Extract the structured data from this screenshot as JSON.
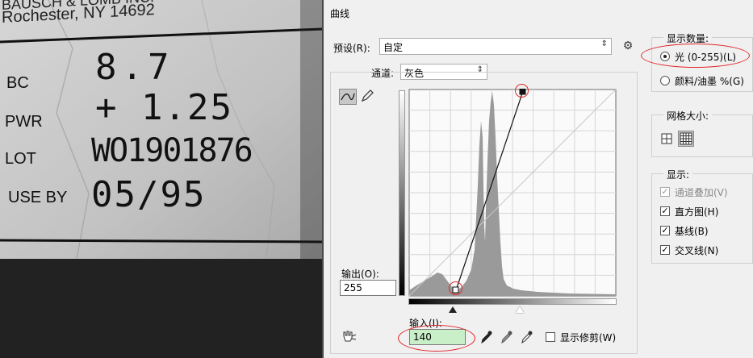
{
  "photo": {
    "header_text": "Rochester, NY 14692",
    "header_partial": "BAUSCH & LOMB INC.",
    "rows": [
      {
        "label": "BC",
        "value": "8.7"
      },
      {
        "label": "PWR",
        "value": "+ 1.25"
      },
      {
        "label": "LOT",
        "value": "WO1901876"
      },
      {
        "label": "USE BY",
        "value": "05/95"
      }
    ]
  },
  "dialog": {
    "title": "曲线",
    "preset_label": "预设(R):",
    "preset_value": "自定",
    "channel_label": "通道:",
    "channel_value": "灰色",
    "output_label": "输出(O):",
    "output_value": "255",
    "input_label": "输入(I):",
    "input_value": "140",
    "show_clipping_label": "显示修剪(W)",
    "display_amount": {
      "title": "显示数量:",
      "option_light": "光 (0-255)(L)",
      "option_pigment": "颜料/油墨 %(G)",
      "selected": "light"
    },
    "grid_size": {
      "title": "网格大小:"
    },
    "show": {
      "title": "显示:",
      "channel_overlays": "通道叠加(V)",
      "histogram": "直方图(H)",
      "baseline": "基线(B)",
      "intersection_line": "交叉线(N)"
    },
    "colors": {
      "highlight_ellipse": "#e0262a",
      "input_field_bg": "#c8efc8"
    }
  }
}
